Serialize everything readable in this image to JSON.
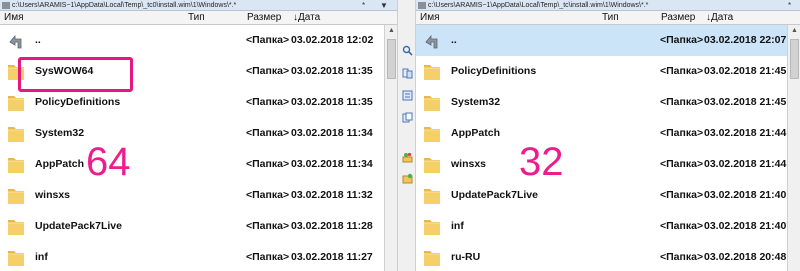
{
  "left": {
    "path": "c:\\Users\\ARAMIS~1\\AppData\\Local\\Temp\\_tc0\\install.wim\\1\\Windows\\*.*",
    "controls": [
      "*",
      "▼"
    ],
    "columns": {
      "name": "Имя",
      "type": "Тип",
      "size": "Размер",
      "date": "↓Дата"
    },
    "rows": [
      {
        "name": "..",
        "type": "<Папка>",
        "date": "03.02.2018 12:02",
        "icon": "up-arrow-icon"
      },
      {
        "name": "SysWOW64",
        "type": "<Папка>",
        "date": "03.02.2018 11:35",
        "icon": "folder-icon"
      },
      {
        "name": "PolicyDefinitions",
        "type": "<Папка>",
        "date": "03.02.2018 11:35",
        "icon": "folder-icon"
      },
      {
        "name": "System32",
        "type": "<Папка>",
        "date": "03.02.2018 11:34",
        "icon": "folder-icon"
      },
      {
        "name": "AppPatch",
        "type": "<Папка>",
        "date": "03.02.2018 11:34",
        "icon": "folder-icon"
      },
      {
        "name": "winsxs",
        "type": "<Папка>",
        "date": "03.02.2018 11:32",
        "icon": "folder-icon"
      },
      {
        "name": "UpdatePack7Live",
        "type": "<Папка>",
        "date": "03.02.2018 11:28",
        "icon": "folder-icon"
      },
      {
        "name": "inf",
        "type": "<Папка>",
        "date": "03.02.2018 11:27",
        "icon": "folder-icon"
      }
    ],
    "annotation": "64"
  },
  "right": {
    "path": "c:\\Users\\ARAMIS~1\\AppData\\Local\\Temp\\_tc\\install.wim\\1\\Windows\\*.*",
    "controls": [
      "*"
    ],
    "columns": {
      "name": "Имя",
      "type": "Тип",
      "size": "Размер",
      "date": "↓Дата"
    },
    "rows": [
      {
        "name": "..",
        "type": "<Папка>",
        "date": "03.02.2018 22:07",
        "icon": "up-arrow-icon",
        "selected": true
      },
      {
        "name": "PolicyDefinitions",
        "type": "<Папка>",
        "date": "03.02.2018 21:45",
        "icon": "folder-icon"
      },
      {
        "name": "System32",
        "type": "<Папка>",
        "date": "03.02.2018 21:45",
        "icon": "folder-icon"
      },
      {
        "name": "AppPatch",
        "type": "<Папка>",
        "date": "03.02.2018 21:44",
        "icon": "folder-icon"
      },
      {
        "name": "winsxs",
        "type": "<Папка>",
        "date": "03.02.2018 21:44",
        "icon": "folder-icon"
      },
      {
        "name": "UpdatePack7Live",
        "type": "<Папка>",
        "date": "03.02.2018 21:40",
        "icon": "folder-icon"
      },
      {
        "name": "inf",
        "type": "<Папка>",
        "date": "03.02.2018 21:40",
        "icon": "folder-icon"
      },
      {
        "name": "ru-RU",
        "type": "<Папка>",
        "date": "03.02.2018 20:48",
        "icon": "folder-icon"
      }
    ],
    "annotation": "32"
  },
  "colors": {
    "highlight": "#e6177f",
    "selection": "#cce4f7",
    "folder": "#f2c55c"
  }
}
